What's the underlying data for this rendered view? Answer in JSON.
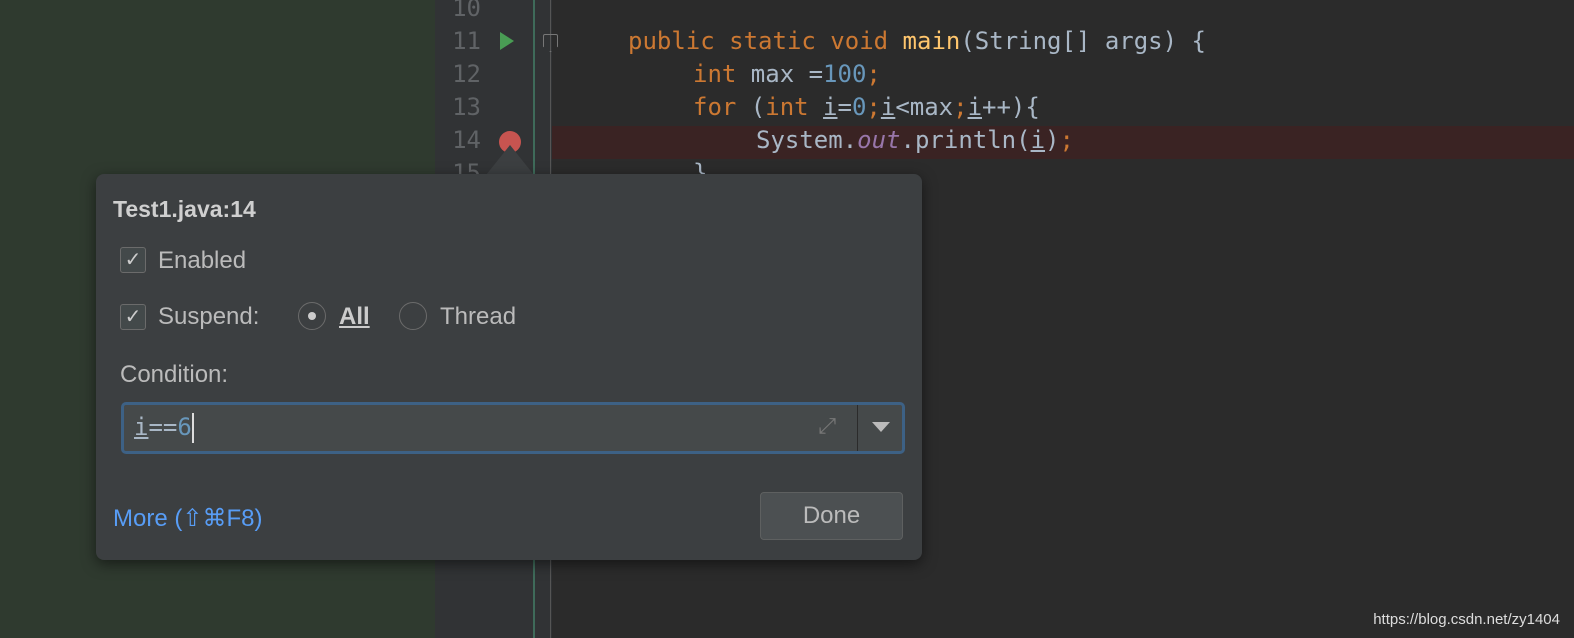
{
  "gutter": {
    "line_numbers": [
      "10",
      "11",
      "12",
      "13",
      "14",
      "15"
    ]
  },
  "code": {
    "line11": [
      [
        "kw",
        "public static void "
      ],
      [
        "fn",
        "main"
      ],
      [
        "",
        "(String[] args) {"
      ]
    ],
    "line12": [
      [
        "kw",
        "int "
      ],
      [
        "",
        "max ="
      ],
      [
        "num",
        "100"
      ],
      [
        "kw",
        ";"
      ]
    ],
    "line13": [
      [
        "kw",
        "for "
      ],
      [
        "",
        "("
      ],
      [
        "kw",
        "int "
      ],
      [
        "u",
        "i"
      ],
      [
        "",
        "="
      ],
      [
        "num",
        "0"
      ],
      [
        "kw",
        ";"
      ],
      [
        "u",
        "i"
      ],
      [
        "",
        "<max"
      ],
      [
        "kw",
        ";"
      ],
      [
        "u",
        "i"
      ],
      [
        "",
        "++){"
      ]
    ],
    "line14": [
      [
        "",
        "System."
      ],
      [
        "st",
        "out"
      ],
      [
        "",
        ".println("
      ],
      [
        "u",
        "i"
      ],
      [
        "",
        ")"
      ],
      [
        "kw",
        ";"
      ]
    ],
    "line15": [
      [
        "",
        "}"
      ]
    ]
  },
  "popup": {
    "title": "Test1.java:14",
    "enabled": {
      "label": "Enabled",
      "checked": true
    },
    "suspend": {
      "label": "Suspend:",
      "checked": true
    },
    "radio_all": {
      "label": "All",
      "selected": true
    },
    "radio_thread": {
      "label": "Thread",
      "selected": false
    },
    "condition_label": "Condition:",
    "condition_var": "i",
    "condition_op": "==",
    "condition_num": "6",
    "more_link": "More (⇧⌘F8)",
    "done_button": "Done"
  },
  "watermark": "https://blog.csdn.net/zy1404",
  "colors": {
    "keyword": "#cc7832",
    "number": "#6897bb",
    "link": "#589df6",
    "breakpoint": "#c75450"
  }
}
